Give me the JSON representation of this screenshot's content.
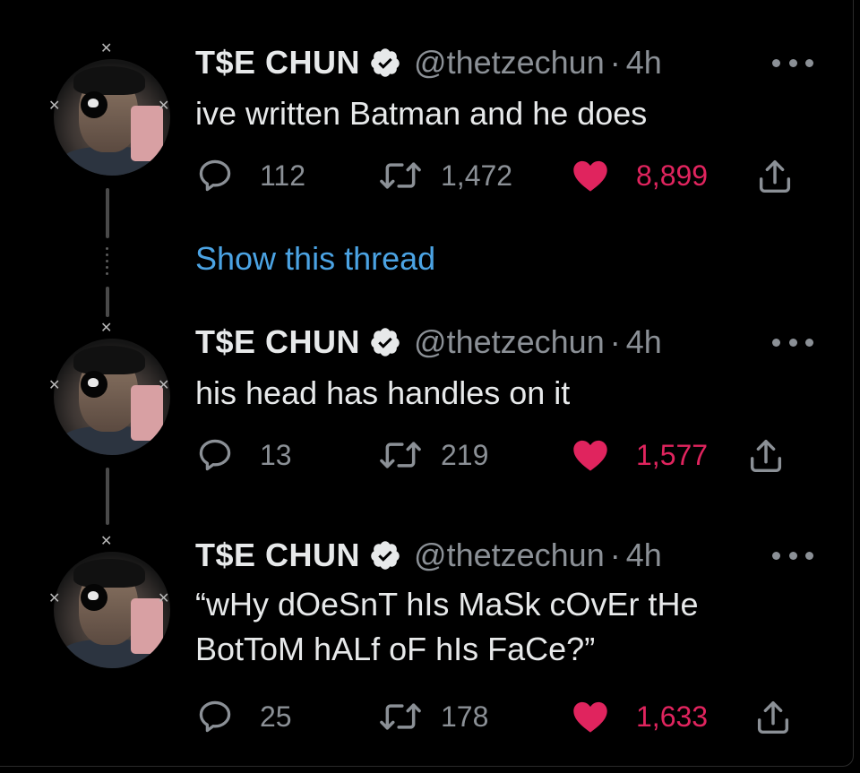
{
  "colors": {
    "background": "#000000",
    "text": "#e7e9ea",
    "muted": "#8b9096",
    "link": "#4ba3e3",
    "like": "#e0245e",
    "verified_badge": "#e7e9ea"
  },
  "show_thread_label": "Show this thread",
  "tweets": [
    {
      "author_name": "T$E CHUN",
      "handle": "@thetzechun",
      "separator": "·",
      "time": "4h",
      "text_lines": [
        "ive written Batman and he does"
      ],
      "replies": "112",
      "retweets": "1,472",
      "likes": "8,899",
      "liked": true
    },
    {
      "author_name": "T$E CHUN",
      "handle": "@thetzechun",
      "separator": "·",
      "time": "4h",
      "text_lines": [
        "his head has handles on it"
      ],
      "replies": "13",
      "retweets": "219",
      "likes": "1,577",
      "liked": true
    },
    {
      "author_name": "T$E CHUN",
      "handle": "@thetzechun",
      "separator": "·",
      "time": "4h",
      "text_lines": [
        "“wHy dOeSnT hIs MaSk cOvEr tHe",
        "BotToM hALf oF hIs FaCe?”"
      ],
      "replies": "25",
      "retweets": "178",
      "likes": "1,633",
      "liked": true
    }
  ]
}
